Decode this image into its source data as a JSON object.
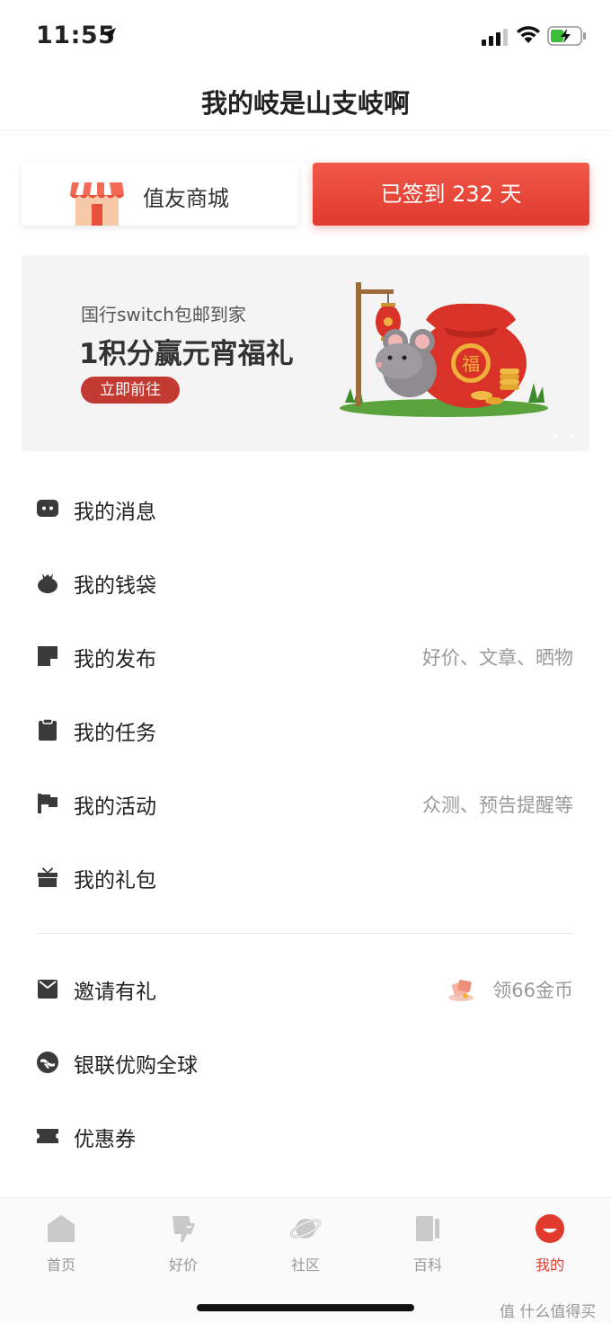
{
  "status_bar": {
    "time": "11:55"
  },
  "nav": {
    "title": "我的岐是山支岐啊"
  },
  "mall": {
    "label": "值友商城"
  },
  "checkin": {
    "label": "已签到 232 天"
  },
  "banner": {
    "subtitle": "国行switch包邮到家",
    "title": "1积分赢元宵福礼",
    "cta": "立即前往"
  },
  "menu": [
    {
      "label": "我的消息",
      "hint": "",
      "icon": "message-icon"
    },
    {
      "label": "我的钱袋",
      "hint": "",
      "icon": "wallet-icon"
    },
    {
      "label": "我的发布",
      "hint": "好价、文章、晒物",
      "icon": "post-icon"
    },
    {
      "label": "我的任务",
      "hint": "",
      "icon": "task-icon"
    },
    {
      "label": "我的活动",
      "hint": "众测、预告提醒等",
      "icon": "flag-icon"
    },
    {
      "label": "我的礼包",
      "hint": "",
      "icon": "gift-icon"
    },
    {
      "label": "邀请有礼",
      "hint": "领66金币",
      "icon": "invite-icon"
    },
    {
      "label": "银联优购全球",
      "hint": "",
      "icon": "unionpay-icon"
    },
    {
      "label": "优惠券",
      "hint": "",
      "icon": "coupon-icon"
    }
  ],
  "tabbar": [
    {
      "label": "首页",
      "icon": "home-icon",
      "active": false
    },
    {
      "label": "好价",
      "icon": "deal-icon",
      "active": false
    },
    {
      "label": "社区",
      "icon": "planet-icon",
      "active": false
    },
    {
      "label": "百科",
      "icon": "book-icon",
      "active": false
    },
    {
      "label": "我的",
      "icon": "profile-icon",
      "active": true
    }
  ],
  "watermark": "值 什么值得买",
  "colors": {
    "accent": "#e23b2e",
    "icon_gray": "#3a3a3a",
    "hint_gray": "#999999"
  }
}
